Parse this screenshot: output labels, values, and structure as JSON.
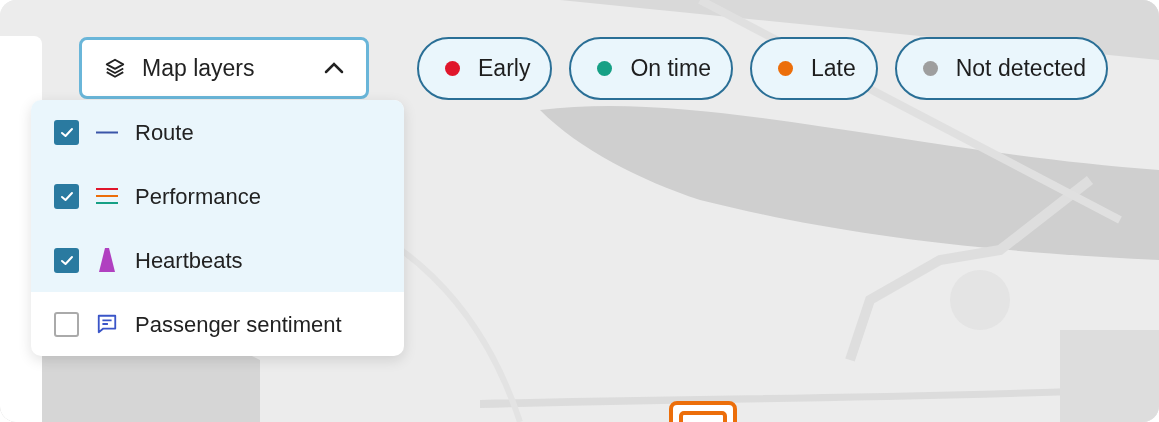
{
  "map_layers_button": {
    "label": "Map layers",
    "expanded": true
  },
  "layers": [
    {
      "label": "Route",
      "checked": true,
      "kind": "route"
    },
    {
      "label": "Performance",
      "checked": true,
      "kind": "performance"
    },
    {
      "label": "Heartbeats",
      "checked": true,
      "kind": "heartbeat"
    },
    {
      "label": "Passenger sentiment",
      "checked": false,
      "kind": "sentiment"
    }
  ],
  "legend": [
    {
      "label": "Early",
      "color": "#e0162b"
    },
    {
      "label": "On time",
      "color": "#16a085"
    },
    {
      "label": "Late",
      "color": "#ec6e0a"
    },
    {
      "label": "Not detected",
      "color": "#9e9e9e"
    }
  ]
}
